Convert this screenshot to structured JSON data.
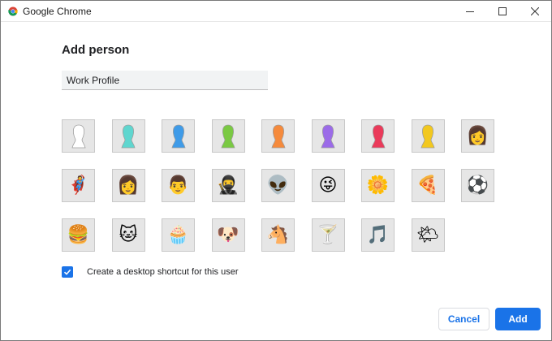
{
  "window": {
    "title": "Google Chrome",
    "icon": "chrome-logo-icon",
    "controls": [
      "minimize-icon",
      "maximize-icon",
      "close-icon"
    ]
  },
  "dialog": {
    "heading": "Add person",
    "name_input": {
      "value": "Work Profile",
      "placeholder": ""
    },
    "avatars": [
      {
        "name": "generic-white",
        "icon": "silhouette",
        "color": "#ffffff"
      },
      {
        "name": "generic-cyan",
        "icon": "silhouette",
        "color": "#5fd6cf"
      },
      {
        "name": "generic-blue",
        "icon": "silhouette",
        "color": "#3f9be8"
      },
      {
        "name": "generic-green",
        "icon": "silhouette",
        "color": "#7ac943"
      },
      {
        "name": "generic-orange",
        "icon": "silhouette",
        "color": "#f58a3c"
      },
      {
        "name": "generic-purple",
        "icon": "silhouette",
        "color": "#9b6be8"
      },
      {
        "name": "generic-red",
        "icon": "silhouette",
        "color": "#ea3a5a"
      },
      {
        "name": "generic-yellow",
        "icon": "silhouette",
        "color": "#f2c81f"
      },
      {
        "name": "secret-agent",
        "icon": "emoji",
        "glyph": "👩"
      },
      {
        "name": "superhero",
        "icon": "emoji",
        "glyph": "🦸"
      },
      {
        "name": "volleyball-player",
        "icon": "emoji",
        "glyph": "👩"
      },
      {
        "name": "businessman",
        "icon": "emoji",
        "glyph": "👨"
      },
      {
        "name": "ninja",
        "icon": "emoji",
        "glyph": "🥷"
      },
      {
        "name": "alien",
        "icon": "emoji",
        "glyph": "👽"
      },
      {
        "name": "awesome",
        "icon": "emoji",
        "glyph": "😜"
      },
      {
        "name": "flower",
        "icon": "emoji",
        "glyph": "🌼"
      },
      {
        "name": "pizza",
        "icon": "emoji",
        "glyph": "🍕"
      },
      {
        "name": "soccer",
        "icon": "emoji",
        "glyph": "⚽"
      },
      {
        "name": "burger",
        "icon": "emoji",
        "glyph": "🍔"
      },
      {
        "name": "cat",
        "icon": "emoji",
        "glyph": "🐱"
      },
      {
        "name": "cupcake",
        "icon": "emoji",
        "glyph": "🧁"
      },
      {
        "name": "dog",
        "icon": "emoji",
        "glyph": "🐶"
      },
      {
        "name": "horse",
        "icon": "emoji",
        "glyph": "🐴"
      },
      {
        "name": "margarita",
        "icon": "emoji",
        "glyph": "🍸"
      },
      {
        "name": "note",
        "icon": "emoji",
        "glyph": "🎵"
      },
      {
        "name": "sun-cloud",
        "icon": "emoji",
        "glyph": "🌤"
      }
    ],
    "shortcut": {
      "checked": true,
      "label": "Create a desktop shortcut for this user"
    },
    "cancel_label": "Cancel",
    "add_label": "Add"
  },
  "colors": {
    "accent": "#1a73e8",
    "input_bg": "#f1f3f4",
    "avatar_bg": "#e6e6e6"
  }
}
